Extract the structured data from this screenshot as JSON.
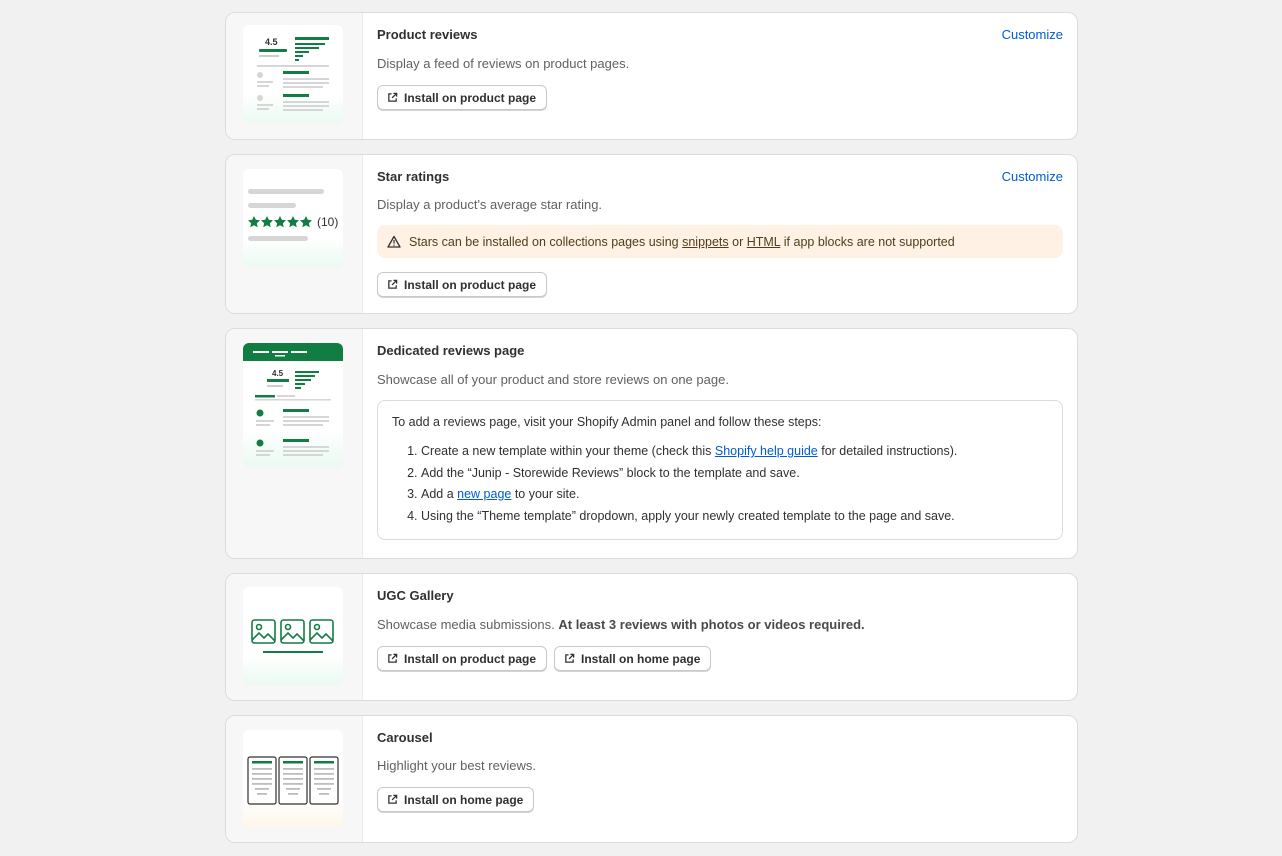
{
  "cards": {
    "product_reviews": {
      "title": "Product reviews",
      "description": "Display a feed of reviews on product pages.",
      "customize": "Customize",
      "thumb_rating": "4.5",
      "buttons": [
        "Install on product page"
      ]
    },
    "star_ratings": {
      "title": "Star ratings",
      "description": "Display a product's average star rating.",
      "customize": "Customize",
      "thumb_count": "(10)",
      "banner": {
        "before": "Stars can be installed on collections pages using ",
        "link1": "snippets",
        "middle": " or ",
        "link2": "HTML",
        "after": " if app blocks are not supported"
      },
      "buttons": [
        "Install on product page"
      ]
    },
    "dedicated": {
      "title": "Dedicated reviews page",
      "description": "Showcase all of your product and store reviews on one page.",
      "thumb_rating": "4.5",
      "intro": "To add a reviews page, visit your Shopify Admin panel and follow these steps:",
      "steps": {
        "s1_before": "Create a new template within your theme (check this ",
        "s1_link": "Shopify help guide",
        "s1_after": " for detailed instructions).",
        "s2": "Add the “Junip - Storewide Reviews” block to the template and save.",
        "s3_before": "Add a ",
        "s3_link": "new page",
        "s3_after": " to your site.",
        "s4": "Using the “Theme template” dropdown, apply your newly created template to the page and save."
      }
    },
    "ugc": {
      "title": "UGC Gallery",
      "description": "Showcase media submissions. ",
      "description_bold": "At least 3 reviews with photos or videos required.",
      "buttons": [
        "Install on product page",
        "Install on home page"
      ]
    },
    "carousel": {
      "title": "Carousel",
      "description": "Highlight your best reviews.",
      "buttons": [
        "Install on home page"
      ]
    }
  },
  "colors": {
    "brand_green": "#127d43",
    "link_blue": "#005bd3",
    "warning_bg": "#fff1e3"
  }
}
